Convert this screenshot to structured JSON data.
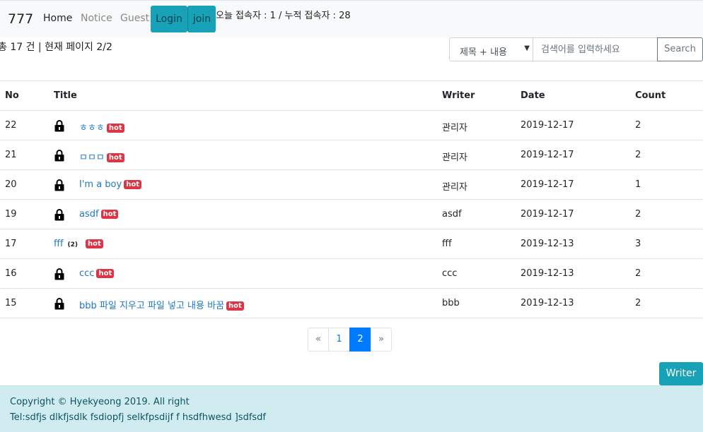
{
  "nav": {
    "brand": "777",
    "home": "Home",
    "notice": "Notice",
    "guest": "Guest",
    "login": "Login",
    "join": "join",
    "visitor_stats": "오늘 접속자 : 1 / 누적 접속자 : 28"
  },
  "summary": "총 17 건 | 현재 페이지 2/2",
  "search": {
    "selected_option": "제목 + 내용",
    "placeholder": "검색어를 입력하세요",
    "value": "",
    "button": "Search"
  },
  "table": {
    "headers": {
      "no": "No",
      "title": "Title",
      "writer": "Writer",
      "date": "Date",
      "count": "Count"
    },
    "rows": [
      {
        "no": "22",
        "locked": true,
        "title": "ㅎㅎㅎ",
        "replies": "",
        "hot": "hot",
        "writer": "관리자",
        "date": "2019-12-17",
        "count": "2"
      },
      {
        "no": "21",
        "locked": true,
        "title": "ㅁㅁㅁ",
        "replies": "",
        "hot": "hot",
        "writer": "관리자",
        "date": "2019-12-17",
        "count": "2"
      },
      {
        "no": "20",
        "locked": true,
        "title": "I'm a boy",
        "replies": "",
        "hot": "hot",
        "writer": "관리자",
        "date": "2019-12-17",
        "count": "1"
      },
      {
        "no": "19",
        "locked": true,
        "title": "asdf",
        "replies": "",
        "hot": "hot",
        "writer": "asdf",
        "date": "2019-12-17",
        "count": "2"
      },
      {
        "no": "17",
        "locked": false,
        "title": "fff",
        "replies": "(2)",
        "hot": "hot",
        "writer": "fff",
        "date": "2019-12-13",
        "count": "3"
      },
      {
        "no": "16",
        "locked": true,
        "title": "ccc",
        "replies": "",
        "hot": "hot",
        "writer": "ccc",
        "date": "2019-12-13",
        "count": "2"
      },
      {
        "no": "15",
        "locked": true,
        "title": "bbb 파일 지우고 파일 넣고 내용 바꿈",
        "replies": "",
        "hot": "hot",
        "writer": "bbb",
        "date": "2019-12-13",
        "count": "2"
      }
    ]
  },
  "pagination": {
    "prev": "«",
    "pages": [
      "1",
      "2"
    ],
    "current": "2",
    "next": "»"
  },
  "writer_button": "Writer",
  "footer": {
    "copyright": "Copyright © Hyekyeong 2019. All right",
    "tel": "Tel:sdfjs dlkfjsdlk fsdiopfj selkfpsdijf f hsdfhwesd ]sdfsdf"
  },
  "colors": {
    "info": "#17a2b8",
    "primary": "#007bff",
    "danger": "#dc3545",
    "link": "#1e78c8",
    "footer_bg": "#d1ecf1"
  }
}
